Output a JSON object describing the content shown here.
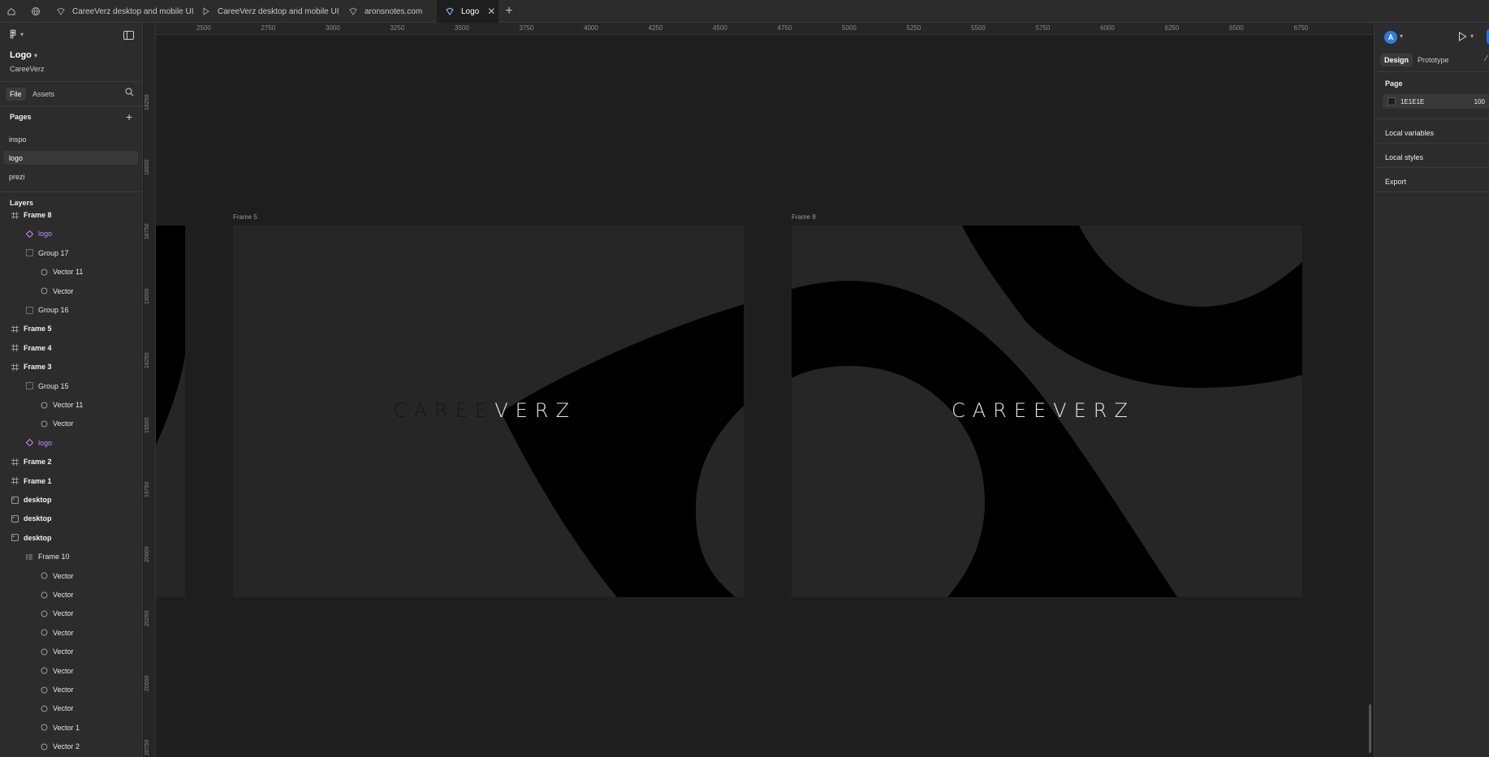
{
  "tabs": [
    {
      "label": "CareeVerz desktop and mobile UI_fina",
      "icon": "figma-file-icon"
    },
    {
      "label": "CareeVerz desktop and mobile UI_fina",
      "icon": "prototype-play-icon"
    },
    {
      "label": "aronsnotes.com",
      "icon": "figma-file-icon"
    },
    {
      "label": "Logo",
      "icon": "figma-file-icon"
    }
  ],
  "file": {
    "name": "Logo",
    "project": "CareeVerz"
  },
  "file_tabs": [
    "File",
    "Assets"
  ],
  "pages": {
    "title": "Pages",
    "items": [
      "inspo",
      "logo",
      "prezi"
    ],
    "active": "logo"
  },
  "layers": {
    "title": "Layers",
    "items": [
      {
        "label": "Frame 8",
        "indent": 0,
        "kind": "frame",
        "bold": true
      },
      {
        "label": "logo",
        "indent": 1,
        "kind": "component",
        "purple": true
      },
      {
        "label": "Group 17",
        "indent": 1,
        "kind": "group"
      },
      {
        "label": "Vector 11",
        "indent": 2,
        "kind": "vector"
      },
      {
        "label": "Vector",
        "indent": 2,
        "kind": "vector"
      },
      {
        "label": "Group 16",
        "indent": 1,
        "kind": "group"
      },
      {
        "label": "Frame 5",
        "indent": 0,
        "kind": "frame",
        "bold": true
      },
      {
        "label": "Frame 4",
        "indent": 0,
        "kind": "frame",
        "bold": true
      },
      {
        "label": "Frame 3",
        "indent": 0,
        "kind": "frame",
        "bold": true
      },
      {
        "label": "Group 15",
        "indent": 1,
        "kind": "group"
      },
      {
        "label": "Vector 11",
        "indent": 2,
        "kind": "vector"
      },
      {
        "label": "Vector",
        "indent": 2,
        "kind": "vector"
      },
      {
        "label": "logo",
        "indent": 1,
        "kind": "component",
        "purple": true
      },
      {
        "label": "Frame 2",
        "indent": 0,
        "kind": "frame",
        "bold": true
      },
      {
        "label": "Frame 1",
        "indent": 0,
        "kind": "frame",
        "bold": true
      },
      {
        "label": "desktop",
        "indent": 0,
        "kind": "section",
        "bold": true
      },
      {
        "label": "desktop",
        "indent": 0,
        "kind": "section",
        "bold": true
      },
      {
        "label": "desktop",
        "indent": 0,
        "kind": "section",
        "bold": true
      },
      {
        "label": "Frame 10",
        "indent": 1,
        "kind": "autolayout"
      },
      {
        "label": "Vector",
        "indent": 2,
        "kind": "vector"
      },
      {
        "label": "Vector",
        "indent": 2,
        "kind": "vector"
      },
      {
        "label": "Vector",
        "indent": 2,
        "kind": "vector"
      },
      {
        "label": "Vector",
        "indent": 2,
        "kind": "vector"
      },
      {
        "label": "Vector",
        "indent": 2,
        "kind": "vector"
      },
      {
        "label": "Vector",
        "indent": 2,
        "kind": "vector"
      },
      {
        "label": "Vector",
        "indent": 2,
        "kind": "vector"
      },
      {
        "label": "Vector",
        "indent": 2,
        "kind": "vector"
      },
      {
        "label": "Vector 1",
        "indent": 2,
        "kind": "vector"
      },
      {
        "label": "Vector 2",
        "indent": 2,
        "kind": "vector"
      }
    ]
  },
  "canvas": {
    "ruler_top": [
      "2500",
      "2750",
      "3000",
      "3250",
      "3500",
      "3750",
      "4000",
      "4250",
      "4500",
      "4750",
      "5000",
      "5250",
      "5500",
      "5750",
      "6000",
      "6250",
      "6500",
      "6750"
    ],
    "ruler_left": [
      "18250",
      "18500",
      "18750",
      "19000",
      "19250",
      "19500",
      "19750",
      "20000",
      "20250",
      "20500",
      "20750"
    ],
    "frames": [
      {
        "label": "Frame 5",
        "logo_dark": "CAREE",
        "logo_light": "VERZ"
      },
      {
        "label": "Frame 8",
        "logo_text": "CAREEVERZ"
      }
    ],
    "colors": {
      "frame_bg": "#262626",
      "shape": "#000000",
      "logo_light": "#e8e8e8",
      "logo_dark": "#141414"
    }
  },
  "right_panel": {
    "avatar": "A",
    "tabs": [
      "Design",
      "Prototype"
    ],
    "page_section": "Page",
    "page_color": "1E1E1E",
    "page_opacity": "100",
    "sections": [
      "Local variables",
      "Local styles",
      "Export"
    ]
  }
}
